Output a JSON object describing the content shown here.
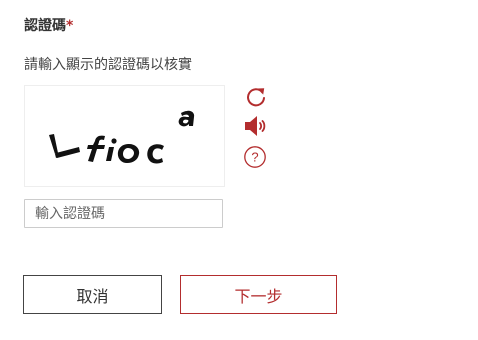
{
  "field": {
    "title": "認證碼",
    "required_mark": "*",
    "instruction": "請輸入顯示的認證碼以核實"
  },
  "captcha": {
    "image_text": "Lfioca",
    "tools": {
      "refresh_icon": "refresh-icon",
      "audio_icon": "speaker-icon",
      "help_icon": "help-icon",
      "help_glyph": "?"
    }
  },
  "input": {
    "value": "",
    "placeholder": "輸入認證碼"
  },
  "buttons": {
    "cancel_label": "取消",
    "next_label": "下一步"
  },
  "colors": {
    "accent": "#b32d2e",
    "text": "#333333",
    "border": "#cccccc"
  }
}
